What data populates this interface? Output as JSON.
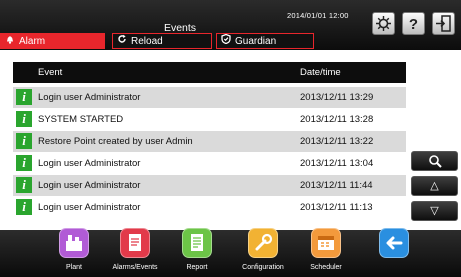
{
  "header": {
    "title": "Events",
    "datetime": "2014/01/01  12:00",
    "top_buttons": [
      {
        "icon": "system-icon"
      },
      {
        "icon": "help-icon"
      },
      {
        "icon": "logout-icon"
      }
    ]
  },
  "tabs": [
    {
      "label": "Alarm",
      "icon": "bell-icon",
      "active": true
    },
    {
      "label": "Reload",
      "icon": "reload-icon",
      "active": false
    },
    {
      "label": "Guardian",
      "icon": "guardian-icon",
      "active": false
    }
  ],
  "table": {
    "columns": [
      "Event",
      "Date/time"
    ],
    "rows": [
      {
        "icon": "info-icon",
        "event": "Login user Administrator",
        "datetime": "2013/12/11 13:29"
      },
      {
        "icon": "info-icon",
        "event": "SYSTEM STARTED",
        "datetime": "2013/12/11 13:28"
      },
      {
        "icon": "info-icon",
        "event": "Restore Point created by user Admin",
        "datetime": "2013/12/11 13:22"
      },
      {
        "icon": "info-icon",
        "event": "Login user Administrator",
        "datetime": "2013/12/11 13:04"
      },
      {
        "icon": "info-icon",
        "event": "Login user Administrator",
        "datetime": "2013/12/11 11:44"
      },
      {
        "icon": "info-icon",
        "event": "Login user Administrator",
        "datetime": "2013/12/11 11:13"
      }
    ]
  },
  "side_buttons": [
    {
      "icon": "search-icon",
      "glyph": "🔍"
    },
    {
      "icon": "scroll-up-icon",
      "glyph": "△"
    },
    {
      "icon": "scroll-down-icon",
      "glyph": "▽"
    }
  ],
  "nav": [
    {
      "label": "Plant",
      "icon": "plant-icon",
      "color": "#b15bd6"
    },
    {
      "label": "Alarms/Events",
      "icon": "alarms-events-icon",
      "color": "#e23a4a"
    },
    {
      "label": "Report",
      "icon": "report-icon",
      "color": "#6cc447"
    },
    {
      "label": "Configuration",
      "icon": "configuration-icon",
      "color": "#f2b233"
    },
    {
      "label": "Scheduler",
      "icon": "scheduler-icon",
      "color": "#f39a3c"
    },
    {
      "label": "",
      "icon": "back-icon",
      "color": "#2a8fe0"
    }
  ],
  "colors": {
    "accent_red": "#e8262c",
    "info_green": "#2aa52e",
    "row_shade": "#dadada"
  }
}
